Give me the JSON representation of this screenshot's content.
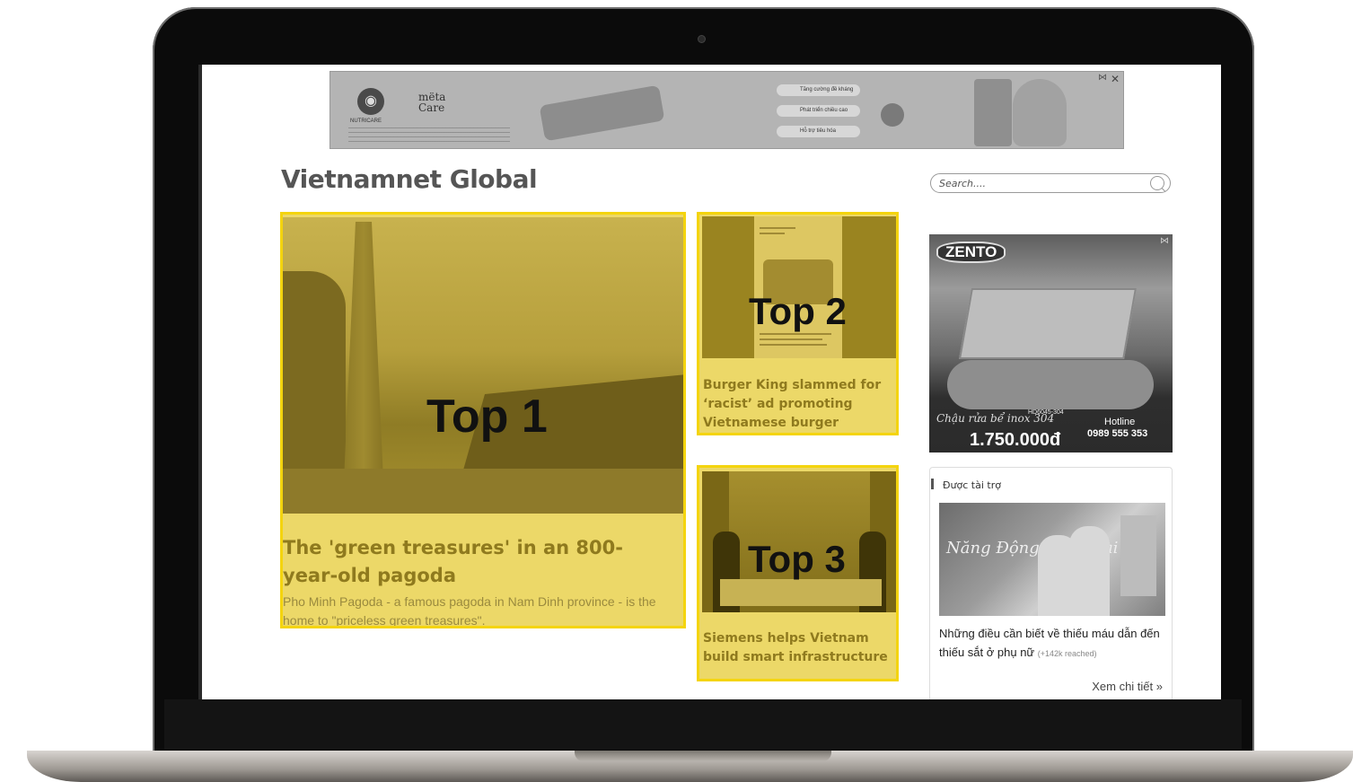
{
  "banner_ad": {
    "brand_line1": "mëta",
    "brand_line2": "Care",
    "maker": "NUTRICARE",
    "ribbon_text": "METACARE ECO CON LỚN KHÔN TOÀN DIỆN",
    "pills": [
      "Tăng cường đề kháng",
      "Phát triển chiều cao",
      "Hỗ trợ tiêu hóa"
    ]
  },
  "site": {
    "title": "Vietnamnet Global",
    "search_placeholder": "Search...."
  },
  "top_stories": [
    {
      "rank_label": "Top 1",
      "headline": "The 'green treasures' in an 800-year-old pagoda",
      "summary": "Pho Minh Pagoda - a famous pagoda in Nam Dinh province - is the home to \"priceless green treasures\"."
    },
    {
      "rank_label": "Top 2",
      "headline": "Burger King slammed for ‘racist’ ad promoting Vietnamese burger"
    },
    {
      "rank_label": "Top 3",
      "headline": "Siemens helps Vietnam build smart infrastructure"
    }
  ],
  "side_ad": {
    "brand": "ZENTO",
    "slogan": "Chậu rửa bể inox 304",
    "model": "HD6045-304",
    "price": "1.750.000đ",
    "hotline_label": "Hotline",
    "hotline": "0989 555 353"
  },
  "sponsored": {
    "label": "Được tài trợ",
    "thumb_text": "Năng Động Ngày dài",
    "article_title": "Những điều cần biết về thiếu máu dẫn đến thiếu sắt ở phụ nữ",
    "reach": "(+142k reached)",
    "more_link": "Xem chi tiết »"
  },
  "colors": {
    "highlight_border": "#f4d40e",
    "highlight_fill": "#ecd868",
    "headline_text": "#8f7a1e"
  }
}
